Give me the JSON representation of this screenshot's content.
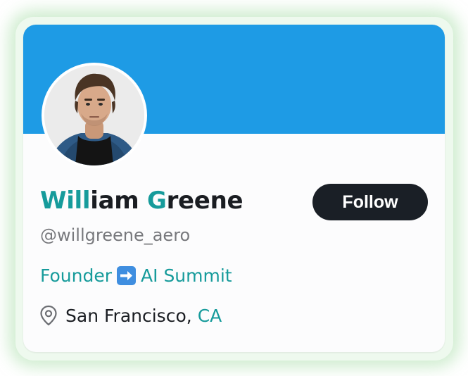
{
  "profile": {
    "name_parts": {
      "first_highlight": "Will",
      "first_rest": "iam",
      "space": " ",
      "last_highlight": "G",
      "last_rest": "reene"
    },
    "handle": "@willgreene_aero",
    "bio": {
      "role": "Founder",
      "separator_icon": "right-arrow-emoji",
      "org": "AI Summit"
    },
    "location": {
      "icon": "map-pin-icon",
      "city": "San Francisco,",
      "region": "CA"
    },
    "follow_label": "Follow",
    "avatar_alt": "profile photo"
  },
  "colors": {
    "banner": "#1e9be5",
    "accent": "#169b9b",
    "button_bg": "#1a1f26",
    "text": "#1a1d22",
    "muted": "#77787c"
  }
}
